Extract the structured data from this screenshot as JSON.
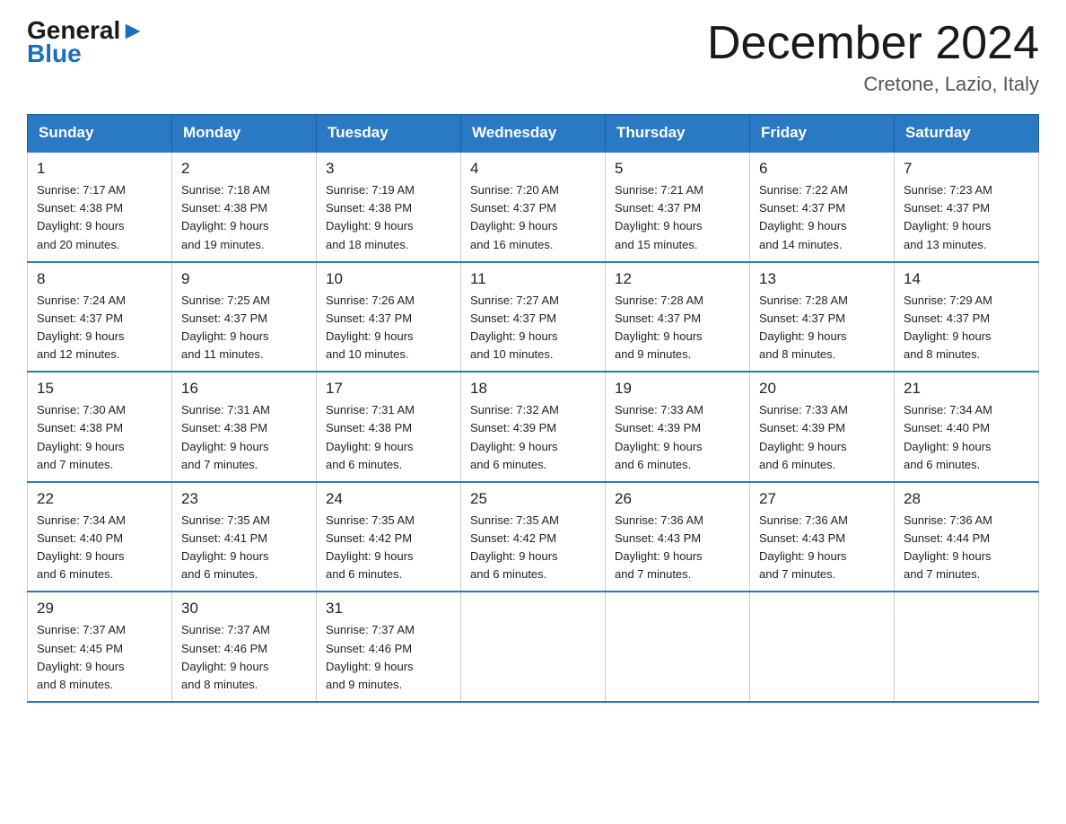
{
  "header": {
    "logo": {
      "general": "General",
      "triangle": "▶",
      "blue": "Blue"
    },
    "title": "December 2024",
    "location": "Cretone, Lazio, Italy"
  },
  "days_of_week": [
    "Sunday",
    "Monday",
    "Tuesday",
    "Wednesday",
    "Thursday",
    "Friday",
    "Saturday"
  ],
  "weeks": [
    [
      {
        "day": "1",
        "sunrise": "7:17 AM",
        "sunset": "4:38 PM",
        "daylight": "9 hours and 20 minutes."
      },
      {
        "day": "2",
        "sunrise": "7:18 AM",
        "sunset": "4:38 PM",
        "daylight": "9 hours and 19 minutes."
      },
      {
        "day": "3",
        "sunrise": "7:19 AM",
        "sunset": "4:38 PM",
        "daylight": "9 hours and 18 minutes."
      },
      {
        "day": "4",
        "sunrise": "7:20 AM",
        "sunset": "4:37 PM",
        "daylight": "9 hours and 16 minutes."
      },
      {
        "day": "5",
        "sunrise": "7:21 AM",
        "sunset": "4:37 PM",
        "daylight": "9 hours and 15 minutes."
      },
      {
        "day": "6",
        "sunrise": "7:22 AM",
        "sunset": "4:37 PM",
        "daylight": "9 hours and 14 minutes."
      },
      {
        "day": "7",
        "sunrise": "7:23 AM",
        "sunset": "4:37 PM",
        "daylight": "9 hours and 13 minutes."
      }
    ],
    [
      {
        "day": "8",
        "sunrise": "7:24 AM",
        "sunset": "4:37 PM",
        "daylight": "9 hours and 12 minutes."
      },
      {
        "day": "9",
        "sunrise": "7:25 AM",
        "sunset": "4:37 PM",
        "daylight": "9 hours and 11 minutes."
      },
      {
        "day": "10",
        "sunrise": "7:26 AM",
        "sunset": "4:37 PM",
        "daylight": "9 hours and 10 minutes."
      },
      {
        "day": "11",
        "sunrise": "7:27 AM",
        "sunset": "4:37 PM",
        "daylight": "9 hours and 10 minutes."
      },
      {
        "day": "12",
        "sunrise": "7:28 AM",
        "sunset": "4:37 PM",
        "daylight": "9 hours and 9 minutes."
      },
      {
        "day": "13",
        "sunrise": "7:28 AM",
        "sunset": "4:37 PM",
        "daylight": "9 hours and 8 minutes."
      },
      {
        "day": "14",
        "sunrise": "7:29 AM",
        "sunset": "4:37 PM",
        "daylight": "9 hours and 8 minutes."
      }
    ],
    [
      {
        "day": "15",
        "sunrise": "7:30 AM",
        "sunset": "4:38 PM",
        "daylight": "9 hours and 7 minutes."
      },
      {
        "day": "16",
        "sunrise": "7:31 AM",
        "sunset": "4:38 PM",
        "daylight": "9 hours and 7 minutes."
      },
      {
        "day": "17",
        "sunrise": "7:31 AM",
        "sunset": "4:38 PM",
        "daylight": "9 hours and 6 minutes."
      },
      {
        "day": "18",
        "sunrise": "7:32 AM",
        "sunset": "4:39 PM",
        "daylight": "9 hours and 6 minutes."
      },
      {
        "day": "19",
        "sunrise": "7:33 AM",
        "sunset": "4:39 PM",
        "daylight": "9 hours and 6 minutes."
      },
      {
        "day": "20",
        "sunrise": "7:33 AM",
        "sunset": "4:39 PM",
        "daylight": "9 hours and 6 minutes."
      },
      {
        "day": "21",
        "sunrise": "7:34 AM",
        "sunset": "4:40 PM",
        "daylight": "9 hours and 6 minutes."
      }
    ],
    [
      {
        "day": "22",
        "sunrise": "7:34 AM",
        "sunset": "4:40 PM",
        "daylight": "9 hours and 6 minutes."
      },
      {
        "day": "23",
        "sunrise": "7:35 AM",
        "sunset": "4:41 PM",
        "daylight": "9 hours and 6 minutes."
      },
      {
        "day": "24",
        "sunrise": "7:35 AM",
        "sunset": "4:42 PM",
        "daylight": "9 hours and 6 minutes."
      },
      {
        "day": "25",
        "sunrise": "7:35 AM",
        "sunset": "4:42 PM",
        "daylight": "9 hours and 6 minutes."
      },
      {
        "day": "26",
        "sunrise": "7:36 AM",
        "sunset": "4:43 PM",
        "daylight": "9 hours and 7 minutes."
      },
      {
        "day": "27",
        "sunrise": "7:36 AM",
        "sunset": "4:43 PM",
        "daylight": "9 hours and 7 minutes."
      },
      {
        "day": "28",
        "sunrise": "7:36 AM",
        "sunset": "4:44 PM",
        "daylight": "9 hours and 7 minutes."
      }
    ],
    [
      {
        "day": "29",
        "sunrise": "7:37 AM",
        "sunset": "4:45 PM",
        "daylight": "9 hours and 8 minutes."
      },
      {
        "day": "30",
        "sunrise": "7:37 AM",
        "sunset": "4:46 PM",
        "daylight": "9 hours and 8 minutes."
      },
      {
        "day": "31",
        "sunrise": "7:37 AM",
        "sunset": "4:46 PM",
        "daylight": "9 hours and 9 minutes."
      },
      null,
      null,
      null,
      null
    ]
  ],
  "labels": {
    "sunrise": "Sunrise:",
    "sunset": "Sunset:",
    "daylight": "Daylight:"
  }
}
